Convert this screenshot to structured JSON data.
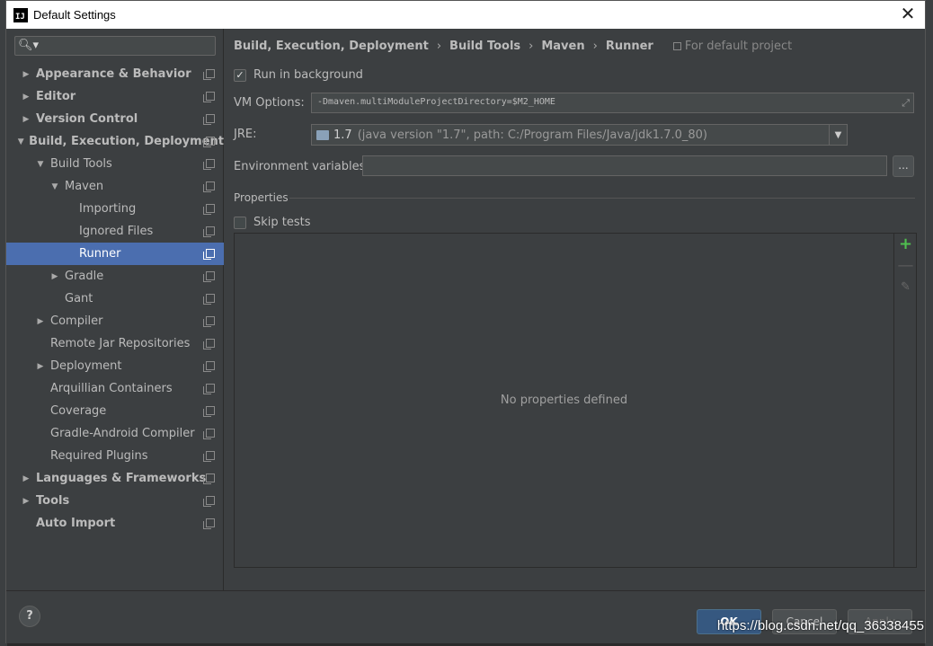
{
  "window": {
    "title": "Default Settings",
    "app_icon": "intellij-logo",
    "app_icon_text": "IJ"
  },
  "sidebar": {
    "search_placeholder": "",
    "tree": [
      {
        "label": "Appearance & Behavior",
        "level": 0,
        "expand": "collapsed",
        "bold": true,
        "name": "tree-appearance-behavior"
      },
      {
        "label": "Editor",
        "level": 0,
        "expand": "collapsed",
        "bold": true,
        "name": "tree-editor"
      },
      {
        "label": "Version Control",
        "level": 0,
        "expand": "collapsed",
        "bold": true,
        "name": "tree-version-control"
      },
      {
        "label": "Build, Execution, Deployment",
        "level": 0,
        "expand": "expanded",
        "bold": true,
        "name": "tree-build-execution-deployment"
      },
      {
        "label": "Build Tools",
        "level": 1,
        "expand": "expanded",
        "bold": false,
        "name": "tree-build-tools"
      },
      {
        "label": "Maven",
        "level": 2,
        "expand": "expanded",
        "bold": false,
        "name": "tree-maven"
      },
      {
        "label": "Importing",
        "level": 3,
        "expand": "none",
        "bold": false,
        "name": "tree-importing"
      },
      {
        "label": "Ignored Files",
        "level": 3,
        "expand": "none",
        "bold": false,
        "name": "tree-ignored-files"
      },
      {
        "label": "Runner",
        "level": 3,
        "expand": "none",
        "bold": false,
        "selected": true,
        "name": "tree-runner"
      },
      {
        "label": "Gradle",
        "level": 2,
        "expand": "collapsed",
        "bold": false,
        "name": "tree-gradle"
      },
      {
        "label": "Gant",
        "level": 2,
        "expand": "none",
        "bold": false,
        "name": "tree-gant"
      },
      {
        "label": "Compiler",
        "level": 1,
        "expand": "collapsed",
        "bold": false,
        "name": "tree-compiler"
      },
      {
        "label": "Remote Jar Repositories",
        "level": 1,
        "expand": "none",
        "bold": false,
        "name": "tree-remote-jar-repositories"
      },
      {
        "label": "Deployment",
        "level": 1,
        "expand": "collapsed",
        "bold": false,
        "name": "tree-deployment"
      },
      {
        "label": "Arquillian Containers",
        "level": 1,
        "expand": "none",
        "bold": false,
        "name": "tree-arquillian-containers"
      },
      {
        "label": "Coverage",
        "level": 1,
        "expand": "none",
        "bold": false,
        "name": "tree-coverage"
      },
      {
        "label": "Gradle-Android Compiler",
        "level": 1,
        "expand": "none",
        "bold": false,
        "name": "tree-gradle-android-compiler"
      },
      {
        "label": "Required Plugins",
        "level": 1,
        "expand": "none",
        "bold": false,
        "name": "tree-required-plugins"
      },
      {
        "label": "Languages & Frameworks",
        "level": 0,
        "expand": "collapsed",
        "bold": true,
        "name": "tree-languages-frameworks"
      },
      {
        "label": "Tools",
        "level": 0,
        "expand": "collapsed",
        "bold": true,
        "name": "tree-tools"
      },
      {
        "label": "Auto Import",
        "level": 0,
        "expand": "none",
        "bold": true,
        "name": "tree-auto-import"
      }
    ]
  },
  "breadcrumb": {
    "items": [
      "Build, Execution, Deployment",
      "Build Tools",
      "Maven",
      "Runner"
    ],
    "separator": "›",
    "for_default": "For default project"
  },
  "runner": {
    "run_in_background": {
      "label": "Run in background",
      "checked": true
    },
    "vm_options": {
      "label": "VM Options:",
      "value": "-Dmaven.multiModuleProjectDirectory=$M2_HOME"
    },
    "jre": {
      "label": "JRE:",
      "name": "1.7",
      "detail": "(java version \"1.7\", path: C:/Program Files/Java/jdk1.7.0_80)"
    },
    "env_vars": {
      "label": "Environment variables:",
      "value": "",
      "button": "..."
    },
    "properties": {
      "section": "Properties",
      "skip_tests": {
        "label": "Skip tests",
        "checked": false
      },
      "empty_text": "No properties defined"
    }
  },
  "toolbar": {
    "add": "+",
    "remove": "—",
    "edit": "✎"
  },
  "footer": {
    "help": "?",
    "ok": "OK",
    "cancel": "Cancel",
    "apply": "Apply"
  },
  "watermark": "https://blog.csdn.net/qq_36338455",
  "colors": {
    "selection": "#4b6eaf",
    "background": "#3c3f41",
    "primary_button": "#365880",
    "add_icon": "#4fbf4f"
  }
}
